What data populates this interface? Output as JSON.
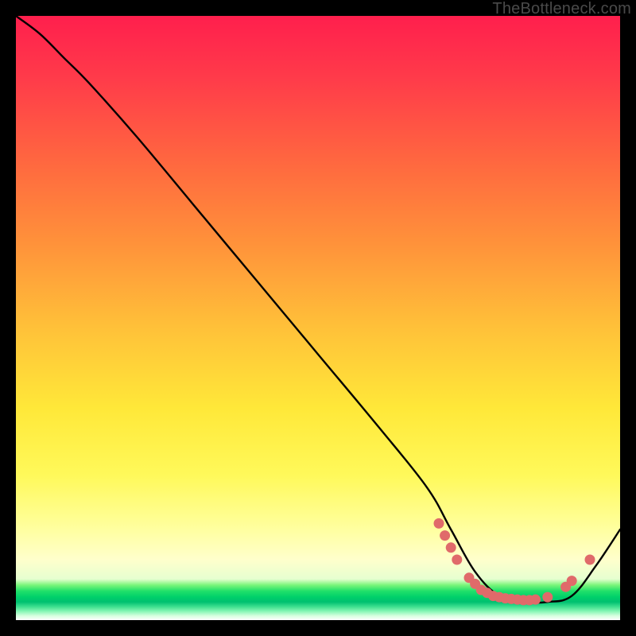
{
  "watermark": "TheBottleneck.com",
  "chart_data": {
    "type": "line",
    "title": "",
    "xlabel": "",
    "ylabel": "",
    "xlim": [
      0,
      100
    ],
    "ylim": [
      0,
      100
    ],
    "series": [
      {
        "name": "curve",
        "x": [
          0,
          4,
          8,
          12,
          20,
          30,
          40,
          50,
          60,
          68,
          72,
          76,
          80,
          84,
          88,
          92,
          96,
          100
        ],
        "y": [
          100,
          97,
          93,
          89,
          80,
          68,
          56,
          44,
          32,
          22,
          15,
          8,
          4,
          3,
          3,
          4,
          9,
          15
        ]
      }
    ],
    "markers": {
      "name": "highlight-dots",
      "x": [
        70,
        71,
        72,
        73,
        75,
        76,
        77,
        78,
        79,
        80,
        81,
        82,
        83,
        84,
        85,
        86,
        88,
        91,
        92,
        95
      ],
      "y": [
        16,
        14,
        12,
        10,
        7,
        6,
        5,
        4.5,
        4,
        3.8,
        3.6,
        3.5,
        3.4,
        3.3,
        3.3,
        3.4,
        3.8,
        5.5,
        6.5,
        10
      ]
    }
  }
}
